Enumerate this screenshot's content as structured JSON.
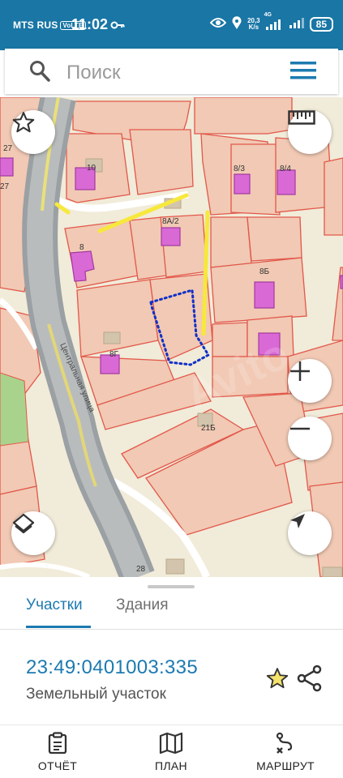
{
  "status_bar": {
    "carrier": "MTS RUS",
    "volte": "VoLTE",
    "time": "11:02",
    "speed_top": "20,3",
    "speed_bottom": "K/s",
    "network": "4G",
    "battery": "85"
  },
  "search": {
    "placeholder": "Поиск",
    "icon": "search-icon",
    "menu_icon": "hamburger-menu-icon"
  },
  "map": {
    "labels": {
      "p27": "27",
      "p27b": "27",
      "p10": "10",
      "p8_3": "8/3",
      "p8_4": "8/4",
      "p8a2": "8А/2",
      "p8": "8",
      "p8b": "8Б",
      "p8g": "8Г",
      "p21b": "21Б",
      "p28": "28",
      "street": "Центральная улица"
    },
    "controls": [
      "favorite-star-icon",
      "ruler-icon",
      "zoom-in-icon",
      "zoom-out-icon",
      "layers-icon",
      "navigation-arrow-icon"
    ],
    "colors": {
      "parcel_fill": "#f1c9b4",
      "parcel_stroke": "#e2574a",
      "building": "#d96ad5",
      "selected_outline": "#1030c8",
      "highlight": "#f7e83c"
    }
  },
  "sheet": {
    "tabs": [
      {
        "label": "Участки",
        "active": true
      },
      {
        "label": "Здания",
        "active": false
      }
    ],
    "cadastral_number": "23:49:0401003:335",
    "object_type": "Земельный участок"
  },
  "bottom_nav": {
    "items": [
      {
        "label": "ОТЧЁТ",
        "icon": "report-icon"
      },
      {
        "label": "ПЛАН",
        "icon": "map-plan-icon"
      },
      {
        "label": "МАРШРУТ",
        "icon": "route-icon"
      }
    ]
  }
}
